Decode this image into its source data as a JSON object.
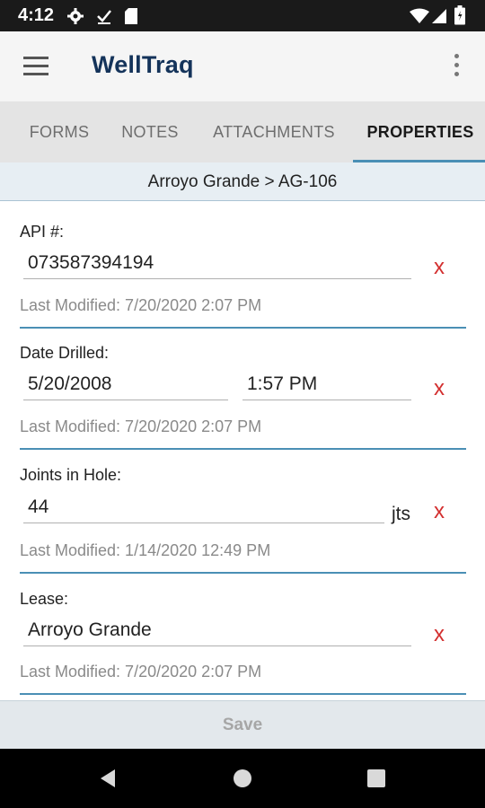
{
  "status_bar": {
    "time": "4:12",
    "icons": [
      "gear-icon",
      "download-done-icon",
      "sd-card-icon",
      "wifi-icon",
      "signal-icon",
      "battery-icon"
    ]
  },
  "app_bar": {
    "title": "WellTraq",
    "title_color": "#14335a"
  },
  "tabs": [
    {
      "label": "FORMS"
    },
    {
      "label": "NOTES"
    },
    {
      "label": "ATTACHMENTS"
    },
    {
      "label": "PROPERTIES",
      "active": true
    }
  ],
  "breadcrumb": "Arroyo Grande > AG-106",
  "fields": {
    "api": {
      "label": "API #:",
      "value": "073587394194",
      "clear": "x",
      "last_modified": "Last Modified: 7/20/2020 2:07 PM"
    },
    "date_drilled": {
      "label": "Date Drilled:",
      "date": "5/20/2008",
      "time": "1:57 PM",
      "clear": "x",
      "last_modified": "Last Modified: 7/20/2020 2:07 PM"
    },
    "joints": {
      "label": "Joints in Hole:",
      "value": "44",
      "unit": "jts",
      "clear": "x",
      "last_modified": "Last Modified: 1/14/2020 12:49 PM"
    },
    "lease": {
      "label": "Lease:",
      "value": "Arroyo Grande",
      "clear": "x",
      "last_modified": "Last Modified: 7/20/2020 2:07 PM"
    }
  },
  "save_bar": {
    "label": "Save"
  },
  "colors": {
    "accent": "#4a8fb5",
    "clear": "#d32f2f",
    "status_bar": "#1a1a1a"
  }
}
